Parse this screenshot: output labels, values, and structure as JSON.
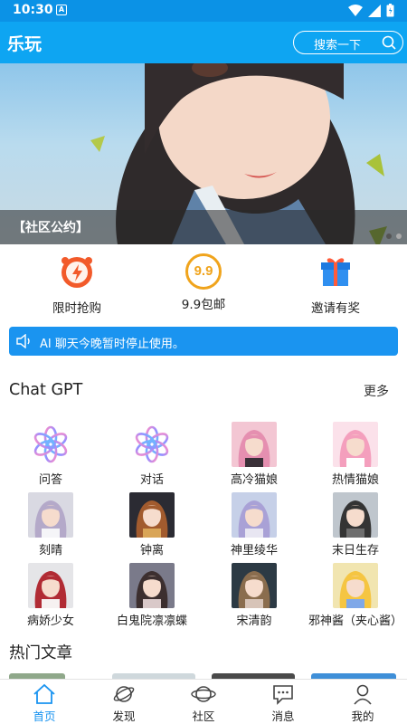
{
  "status_bar": {
    "time": "10:30",
    "notif_glyph": "A"
  },
  "app_bar": {
    "title": "乐玩",
    "search_placeholder": "搜索一下"
  },
  "banner": {
    "caption": "【社区公约】",
    "slide_count": 2,
    "active_slide": 1
  },
  "quick_actions": [
    {
      "label": "限时抢购",
      "icon": "alarm-clock-icon"
    },
    {
      "label": "9.9包邮",
      "icon": "nine-nine-badge-icon",
      "badge": "9.9"
    },
    {
      "label": "邀请有奖",
      "icon": "gift-box-icon"
    }
  ],
  "notice": {
    "text": "AI 聊天今晚暂时停止使用。",
    "icon": "speaker-icon"
  },
  "chat_gpt_section": {
    "title": "Chat GPT",
    "more": "更多"
  },
  "characters": [
    {
      "label": "问答",
      "type": "openai-logo"
    },
    {
      "label": "对话",
      "type": "openai-logo"
    },
    {
      "label": "高冷猫娘",
      "type": "avatar"
    },
    {
      "label": "热情猫娘",
      "type": "avatar"
    },
    {
      "label": "刻晴",
      "type": "avatar"
    },
    {
      "label": "钟离",
      "type": "avatar"
    },
    {
      "label": "神里绫华",
      "type": "avatar"
    },
    {
      "label": "末日生存",
      "type": "avatar"
    },
    {
      "label": "病娇少女",
      "type": "avatar"
    },
    {
      "label": "白鬼院凛凛蝶",
      "type": "avatar"
    },
    {
      "label": "宋清韵",
      "type": "avatar"
    },
    {
      "label": "邪神酱（夹心酱）",
      "type": "avatar"
    }
  ],
  "hot_articles": {
    "title": "热门文章"
  },
  "tabs": [
    {
      "label": "首页",
      "icon": "home-icon",
      "active": true
    },
    {
      "label": "发现",
      "icon": "planet-icon",
      "active": false
    },
    {
      "label": "社区",
      "icon": "orbit-icon",
      "active": false
    },
    {
      "label": "消息",
      "icon": "message-icon",
      "active": false
    },
    {
      "label": "我的",
      "icon": "profile-icon",
      "active": false
    }
  ],
  "colors": {
    "brand": "#0ea5f2",
    "notice": "#1a94f0",
    "status_bar": "#0b92e6"
  }
}
